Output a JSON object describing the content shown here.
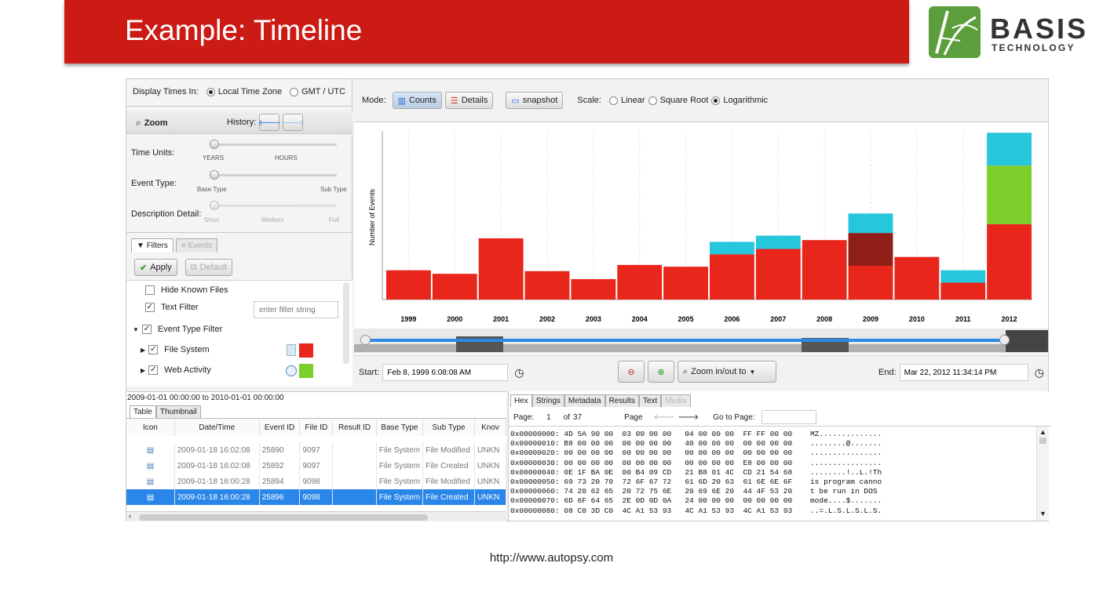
{
  "slide": {
    "title": "Example: Timeline",
    "footer": "http://www.autopsy.com"
  },
  "logo": {
    "word1": "BASIS",
    "word2": "TECHNOLOGY"
  },
  "left": {
    "display_times": "Display Times In:",
    "local_tz": "Local Time Zone",
    "gmt": "GMT / UTC",
    "zoom": "Zoom",
    "history": "History:",
    "time_units": "Time Units:",
    "years": "YEARS",
    "hours": "HOURS",
    "event_type": "Event Type:",
    "base_type": "Base Type",
    "sub_type": "Sub Type",
    "desc_detail": "Description Detail:",
    "short": "Short",
    "medium": "Medium",
    "full": "Full",
    "filters_tab": "Filters",
    "events_tab": "Events",
    "apply": "Apply",
    "default": "Default",
    "filters": [
      {
        "label": "Hide Known Files",
        "checked": false
      },
      {
        "label": "Text Filter",
        "checked": true
      },
      {
        "label": "Event Type Filter",
        "checked": true
      },
      {
        "label": "File System",
        "checked": true
      },
      {
        "label": "Web Activity",
        "checked": true
      }
    ],
    "filter_placeholder": "enter filter string"
  },
  "toolbar": {
    "mode": "Mode:",
    "counts": "Counts",
    "details": "Details",
    "snapshot": "snapshot",
    "scale": "Scale:",
    "linear": "Linear",
    "sqrt": "Square Root",
    "log": "Logarithmic"
  },
  "chart_data": {
    "type": "bar",
    "ylabel": "Number of Events",
    "categories": [
      "1999",
      "2000",
      "2001",
      "2002",
      "2003",
      "2004",
      "2005",
      "2006",
      "2007",
      "2008",
      "2009",
      "2010",
      "2011",
      "2012"
    ],
    "series": [
      {
        "color": "#e8261c",
        "values": [
          33,
          29,
          69,
          32,
          23,
          39,
          37,
          51,
          57,
          67,
          38,
          48,
          19,
          85
        ]
      },
      {
        "color": "#8e1e16",
        "values": [
          0,
          0,
          0,
          0,
          0,
          0,
          0,
          0,
          0,
          0,
          37,
          0,
          0,
          0
        ]
      },
      {
        "color": "#7ccf2a",
        "values": [
          0,
          0,
          0,
          0,
          0,
          0,
          0,
          0,
          0,
          0,
          0,
          0,
          0,
          66
        ]
      },
      {
        "color": "#26c6dc",
        "values": [
          0,
          0,
          0,
          0,
          0,
          0,
          0,
          14,
          15,
          0,
          22,
          0,
          14,
          37
        ]
      }
    ],
    "ylim": [
      0,
      190
    ]
  },
  "range": {
    "start_label": "Start:",
    "start": "Feb 8, 1999 6:08:08 AM",
    "end_label": "End:",
    "end": "Mar 22, 2012 11:34:14 PM",
    "zoom_inout": "Zoom in/out to"
  },
  "table": {
    "range": "2009-01-01 00:00:00 to 2010-01-01 00:00:00",
    "tabs": [
      "Table",
      "Thumbnail"
    ],
    "columns": [
      "Icon",
      "Date/Time",
      "Event ID",
      "File ID",
      "Result ID",
      "Base Type",
      "Sub Type",
      "Knov"
    ],
    "rows": [
      [
        "2009-01-18 16:02:08",
        "25890",
        "9097",
        "",
        "File System",
        "File Modified",
        "UNKN"
      ],
      [
        "2009-01-18 16:02:08",
        "25892",
        "9097",
        "",
        "File System",
        "File Created",
        "UNKN"
      ],
      [
        "2009-01-18 16:00:28",
        "25894",
        "9098",
        "",
        "File System",
        "File Modified",
        "UNKN"
      ],
      [
        "2009-01-18 16:00:28",
        "25896",
        "9098",
        "",
        "File System",
        "File Created",
        "UNKN"
      ]
    ]
  },
  "hex": {
    "tabs": [
      "Hex",
      "Strings",
      "Metadata",
      "Results",
      "Text",
      "Media"
    ],
    "page_label": "Page:",
    "page": "1",
    "of": "of",
    "total": "37",
    "page2": "Page",
    "goto": "Go to Page:",
    "lines": [
      "0x00000000: 4D 5A 90 00  03 00 00 00   04 00 00 00  FF FF 00 00    MZ..............",
      "0x00000010: B8 00 00 00  00 00 00 00   40 00 00 00  00 00 00 00    ........@.......",
      "0x00000020: 00 00 00 00  00 00 00 00   00 00 00 00  00 00 00 00    ................",
      "0x00000030: 00 00 00 00  00 00 00 00   00 00 00 00  E8 00 00 00    ................",
      "0x00000040: 0E 1F BA 0E  00 B4 09 CD   21 B8 01 4C  CD 21 54 68    ........!..L.!Th",
      "0x00000050: 69 73 20 70  72 6F 67 72   61 6D 20 63  61 6E 6E 6F    is program canno",
      "0x00000060: 74 20 62 65  20 72 75 6E   20 69 6E 20  44 4F 53 20    t be run in DOS ",
      "0x00000070: 6D 6F 64 65  2E 0D 0D 0A   24 00 00 00  00 00 00 00    mode....$.......",
      "0x00000080: 08 C0 3D C0  4C A1 53 93   4C A1 53 93  4C A1 53 93    ..=.L.S.L.S.L.S."
    ]
  }
}
